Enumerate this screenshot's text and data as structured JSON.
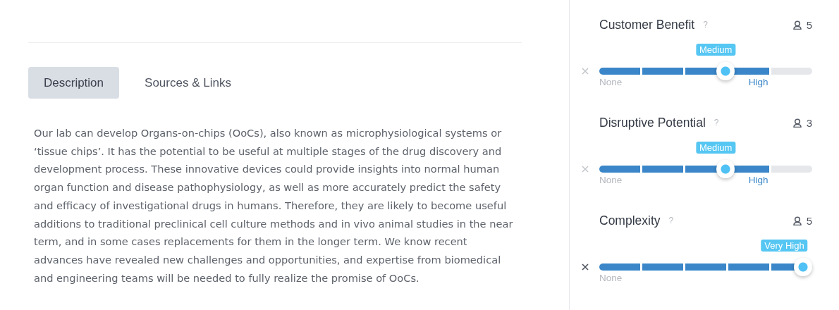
{
  "tabs": [
    {
      "label": "Description",
      "selected": true
    },
    {
      "label": "Sources & Links",
      "selected": false
    }
  ],
  "description": "Our lab can develop Organs-on-chips (OoCs), also known as microphysiological systems or ‘tissue chips’. It has the potential to be useful at multiple stages of the drug discovery and development process. These innovative devices could provide insights into normal human organ function and disease pathophysiology, as well as more accurately predict the safety and efficacy of investigational drugs in humans. Therefore, they are likely to become useful additions to traditional preclinical cell culture methods and in vivo animal studies in the near term, and in some cases replacements for them in the longer term. We know recent advances have revealed new challenges and opportunities, and expertise from biomedical and engineering teams will be needed to fully realize the promise of OoCs.",
  "ratings": [
    {
      "title": "Customer Benefit",
      "help": "?",
      "voters": "5",
      "value_label": "Medium",
      "level": 0.6,
      "min_label": "None",
      "max_label": "High"
    },
    {
      "title": "Disruptive Potential",
      "help": "?",
      "voters": "3",
      "value_label": "Medium",
      "level": 0.6,
      "min_label": "None",
      "max_label": "High"
    },
    {
      "title": "Complexity",
      "help": "?",
      "voters": "5",
      "value_label": "Very High",
      "level": 1,
      "min_label": "None"
    }
  ]
}
